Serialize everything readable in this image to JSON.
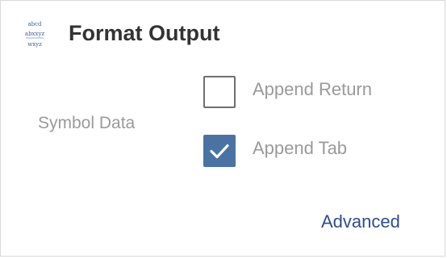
{
  "header": {
    "icon": "format-output-icon",
    "title": "Format Output"
  },
  "symbol_data": {
    "label": "Symbol Data"
  },
  "options": [
    {
      "label": "Append Return",
      "checked": false
    },
    {
      "label": "Append Tab",
      "checked": true
    }
  ],
  "advanced": {
    "label": "Advanced"
  },
  "colors": {
    "checkbox_checked": "#4a73a3",
    "link": "#2f4d8f",
    "label": "#9a9a9a",
    "title": "#333333"
  }
}
